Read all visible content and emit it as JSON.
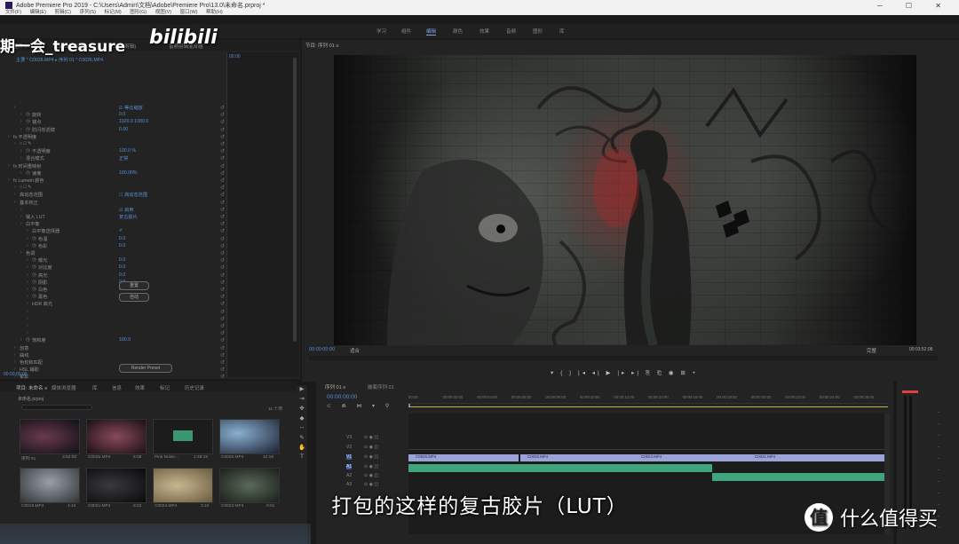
{
  "titlebar": {
    "title": "Adobe Premiere Pro 2019 - C:\\Users\\Admin\\文档\\Adobe\\Premiere Pro\\13.0\\未命名.prproj *",
    "menus": [
      "文件(F)",
      "编辑(E)",
      "剪辑(C)",
      "序列(S)",
      "标记(M)",
      "图形(G)",
      "视图(V)",
      "窗口(W)",
      "帮助(H)"
    ],
    "win_controls": "─ ☐ ✕"
  },
  "workspaces": [
    {
      "label": "学习",
      "active": false
    },
    {
      "label": "组件",
      "active": false
    },
    {
      "label": "编辑",
      "active": true
    },
    {
      "label": "颜色",
      "active": false
    },
    {
      "label": "效果",
      "active": false
    },
    {
      "label": "音频",
      "active": false
    },
    {
      "label": "图形",
      "active": false
    },
    {
      "label": "库",
      "active": false
    }
  ],
  "effect_controls": {
    "tabs": [
      "效果控件 ≡",
      "Lumetri 范围",
      "源：(无剪辑)",
      "音频剪辑混合器"
    ],
    "clip_path": "主要 * C0026.MP4  ▸  序列 01 * C0026.MP4",
    "timeline_tc": "00:00",
    "params": [
      {
        "label": "",
        "value": "☑ 等比缩放",
        "indent": 2,
        "stop": false
      },
      {
        "label": "旋转",
        "value": "0.0",
        "indent": 3,
        "stop": true
      },
      {
        "label": "锚点",
        "value": "1920.0   1080.0",
        "indent": 3,
        "stop": true
      },
      {
        "label": "防闪烁滤镜",
        "value": "0.00",
        "indent": 3,
        "stop": true
      },
      {
        "label": "fx 不透明度",
        "value": "",
        "indent": 1,
        "stop": false
      },
      {
        "label": "○ □ ✎",
        "value": "",
        "indent": 2,
        "stop": false
      },
      {
        "label": "不透明度",
        "value": "100.0 %",
        "indent": 3,
        "stop": true
      },
      {
        "label": "混合模式",
        "value": "正常",
        "indent": 3,
        "stop": false
      },
      {
        "label": "fx 时间重映射",
        "value": "",
        "indent": 1,
        "stop": false
      },
      {
        "label": "速度",
        "value": "100.00%",
        "indent": 3,
        "stop": true
      },
      {
        "label": "fx Lumetri 颜色",
        "value": "",
        "indent": 1,
        "stop": false
      },
      {
        "label": "○ □ ✎",
        "value": "",
        "indent": 2,
        "stop": false
      },
      {
        "label": "高动态范围",
        "value": "☐ 高动态范围",
        "indent": 2,
        "stop": false
      },
      {
        "label": "基本校正",
        "value": "",
        "indent": 2,
        "stop": false
      },
      {
        "label": "",
        "value": "☑ 启用",
        "indent": 3,
        "stop": false
      },
      {
        "label": "输入 LUT",
        "value": "复古胶片",
        "indent": 3,
        "stop": false
      },
      {
        "label": "白平衡",
        "value": "",
        "indent": 3,
        "stop": false
      },
      {
        "label": "白平衡选择器",
        "value": "✐",
        "indent": 4,
        "stop": false
      },
      {
        "label": "色温",
        "value": "0.0",
        "indent": 4,
        "stop": true
      },
      {
        "label": "色彩",
        "value": "0.0",
        "indent": 4,
        "stop": true
      },
      {
        "label": "色调",
        "value": "",
        "indent": 3,
        "stop": false
      },
      {
        "label": "曝光",
        "value": "0.0",
        "indent": 4,
        "stop": true
      },
      {
        "label": "对比度",
        "value": "0.0",
        "indent": 4,
        "stop": true
      },
      {
        "label": "高光",
        "value": "0.0",
        "indent": 4,
        "stop": true
      },
      {
        "label": "阴影",
        "value": "0.0",
        "indent": 4,
        "stop": true
      },
      {
        "label": "白色",
        "value": "0.0",
        "indent": 4,
        "stop": true
      },
      {
        "label": "黑色",
        "value": "0.0",
        "indent": 4,
        "stop": true
      },
      {
        "label": "HDR 高光",
        "value": "",
        "indent": 4,
        "stop": false
      },
      {
        "label": "",
        "value": "",
        "indent": 4,
        "stop": false
      },
      {
        "label": "",
        "value": "",
        "indent": 4,
        "stop": false
      },
      {
        "label": "",
        "value": "",
        "indent": 4,
        "stop": false
      },
      {
        "label": "",
        "value": "",
        "indent": 4,
        "stop": false
      },
      {
        "label": "饱和度",
        "value": "100.0",
        "indent": 3,
        "stop": true
      },
      {
        "label": "创意",
        "value": "",
        "indent": 2,
        "stop": false
      },
      {
        "label": "曲线",
        "value": "",
        "indent": 2,
        "stop": false
      },
      {
        "label": "色轮和匹配",
        "value": "",
        "indent": 2,
        "stop": false
      },
      {
        "label": "HSL 辅助",
        "value": "",
        "indent": 2,
        "stop": false
      },
      {
        "label": "晕影",
        "value": "",
        "indent": 2,
        "stop": false
      },
      {
        "label": "fx 音频",
        "value": "",
        "indent": 1,
        "stop": false
      },
      {
        "label": "○ □ ✎",
        "value": "",
        "indent": 2,
        "stop": false
      },
      {
        "label": "",
        "value": "",
        "indent": 2,
        "stop": false
      },
      {
        "label": "",
        "value": "",
        "indent": 2,
        "stop": false
      }
    ],
    "buttons": {
      "reset": "重置",
      "auto": "自动",
      "render": "Render Preset"
    },
    "footer_tc": "00:00:00:00"
  },
  "program_monitor": {
    "tab": "节目: 序列 01 ≡",
    "left_tc": "00:00:00:00",
    "fit_label": "适合",
    "zoom_label": "完整",
    "right_tc": "00:03:52:08",
    "transport": "▾  {  }  |◂  ◂|  ▶  |▸  ▸|  ⎘  ⎗  ◉  ⊞   +"
  },
  "project": {
    "tabs": [
      {
        "label": "项目: 未命名 ≡",
        "active": true
      },
      {
        "label": "媒体浏览器",
        "active": false
      },
      {
        "label": "库",
        "active": false
      },
      {
        "label": "信息",
        "active": false
      },
      {
        "label": "效果",
        "active": false
      },
      {
        "label": "标记",
        "active": false
      },
      {
        "label": "历史记录",
        "active": false
      }
    ],
    "path": "未命名.prproj",
    "count": "11 个项",
    "items": [
      {
        "name": "序列 01",
        "dur": "3:52:08"
      },
      {
        "name": "C0025.MP4",
        "dur": "5:06"
      },
      {
        "name": "Pink Noise...",
        "dur": "1:48:15"
      },
      {
        "name": "C0026.MP4",
        "dur": "12:18"
      },
      {
        "name": "C0019.MP4",
        "dur": "4:16"
      },
      {
        "name": "C0021.MP4",
        "dur": "8:22"
      },
      {
        "name": "C0024.MP4",
        "dur": "3:10"
      },
      {
        "name": "C0023.MP4",
        "dur": "9:01"
      }
    ]
  },
  "timeline": {
    "tab": "序列 01 ≡",
    "tab2": "嵌套序列 01",
    "timecode": "00:00:00:00",
    "ruler": [
      "00:00",
      "00:00:02:00",
      "00:00:04:00",
      "00:00:06:00",
      "00:00:08:00",
      "00:00:10:00",
      "00:00:12:00",
      "00:00:14:00",
      "00:00:16:00",
      "00:00:18:00",
      "00:00:20:00",
      "00:00:22:00",
      "00:00:24:00",
      "00:00:26:00"
    ],
    "tracks": [
      "V3",
      "V2",
      "V1",
      "A1",
      "A2",
      "A3"
    ],
    "clips": [
      "C0026.MP4",
      "C0025.MP4",
      "C0024.MP4",
      "C0021.MP4"
    ]
  },
  "overlay": {
    "subtitle": "打包的这样的复古胶片（LUT）",
    "uploader": "期一会_treasure",
    "bili_logo": "bilibili",
    "smzdm_logo": "值",
    "smzdm_text": "什么值得买"
  },
  "colors": {
    "accent": "#5a8fd8",
    "video_clip": "#9aa2d8",
    "audio_clip": "#3ea57c",
    "meter_peak": "#e04040"
  }
}
